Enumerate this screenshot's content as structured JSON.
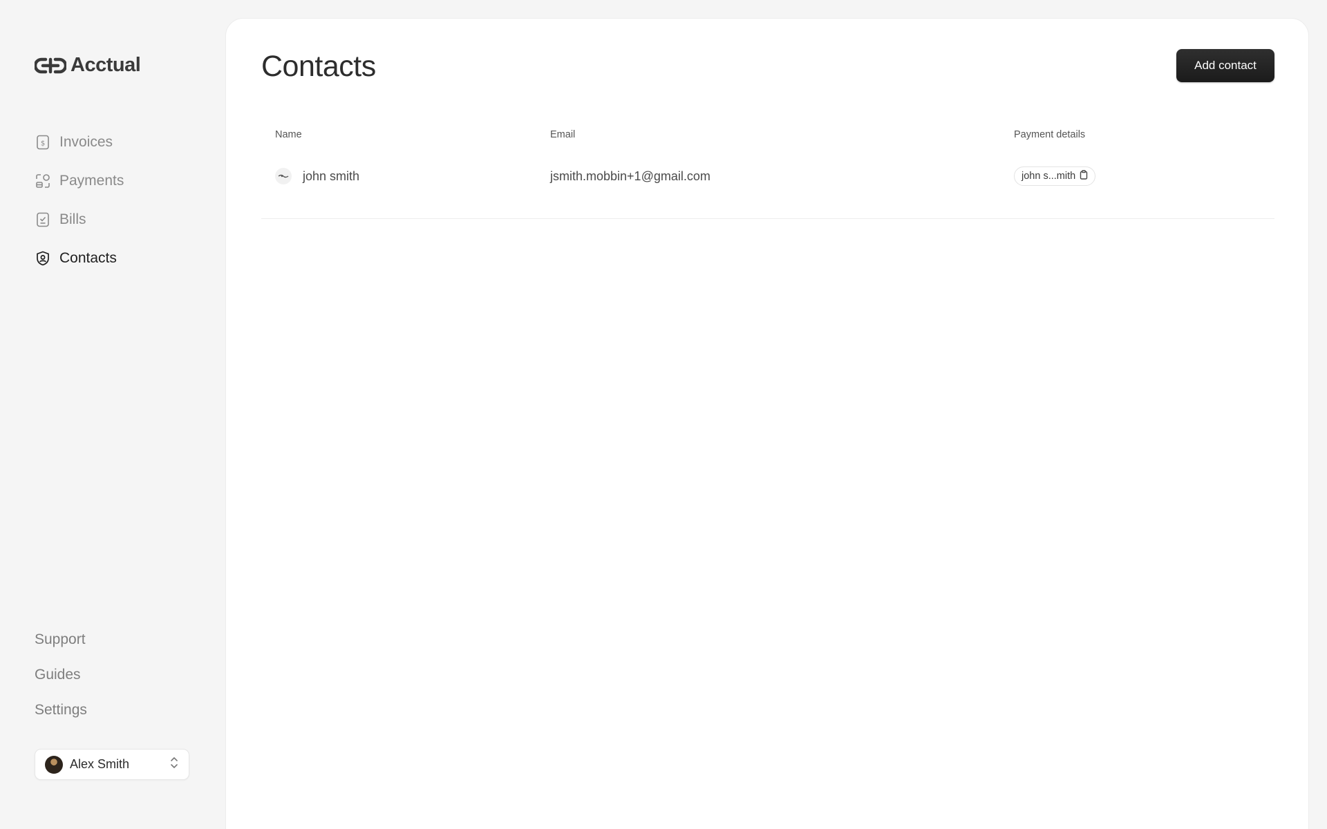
{
  "app": {
    "name": "Acctual"
  },
  "sidebar": {
    "items": [
      {
        "label": "Invoices",
        "icon": "invoice-dollar-icon",
        "active": false
      },
      {
        "label": "Payments",
        "icon": "payments-grid-icon",
        "active": false
      },
      {
        "label": "Bills",
        "icon": "bill-check-icon",
        "active": false
      },
      {
        "label": "Contacts",
        "icon": "contact-shield-icon",
        "active": true
      }
    ],
    "bottom_items": [
      {
        "label": "Support"
      },
      {
        "label": "Guides"
      },
      {
        "label": "Settings"
      }
    ],
    "user": {
      "name": "Alex Smith"
    }
  },
  "main": {
    "title": "Contacts",
    "add_button_label": "Add contact",
    "table": {
      "columns": [
        "Name",
        "Email",
        "Payment details"
      ],
      "rows": [
        {
          "name": "john smith",
          "email": "jsmith.mobbin+1@gmail.com",
          "payment_details": "john s...mith"
        }
      ]
    }
  },
  "colors": {
    "background": "#f5f5f5",
    "panel": "#ffffff",
    "primary_button": "#1f1f1f",
    "muted_text": "#8a8a8a"
  }
}
